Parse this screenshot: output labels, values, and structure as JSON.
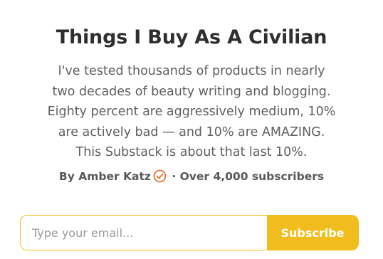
{
  "header": {
    "title": "Things I Buy As A Civilian"
  },
  "description": {
    "lines": [
      "I've tested thousands of products in nearly",
      "two decades of beauty writing and blogging.",
      "Eighty percent are aggressively medium, 10%",
      "are actively bad — and 10% are AMAZING.",
      "This Substack is about that last 10%."
    ]
  },
  "byline": {
    "prefix": "By ",
    "author": "Amber Katz",
    "separator": " · ",
    "subscribers": "Over 4,000 subscribers",
    "verified_icon": "verified-check-circle-icon"
  },
  "subscribe_form": {
    "email_placeholder": "Type your email...",
    "email_value": "",
    "button_label": "Subscribe"
  },
  "colors": {
    "accent": "#f1bd1e",
    "verified": "#e8742b",
    "title": "#2f2f2f",
    "body_text": "#5f5f5f"
  }
}
